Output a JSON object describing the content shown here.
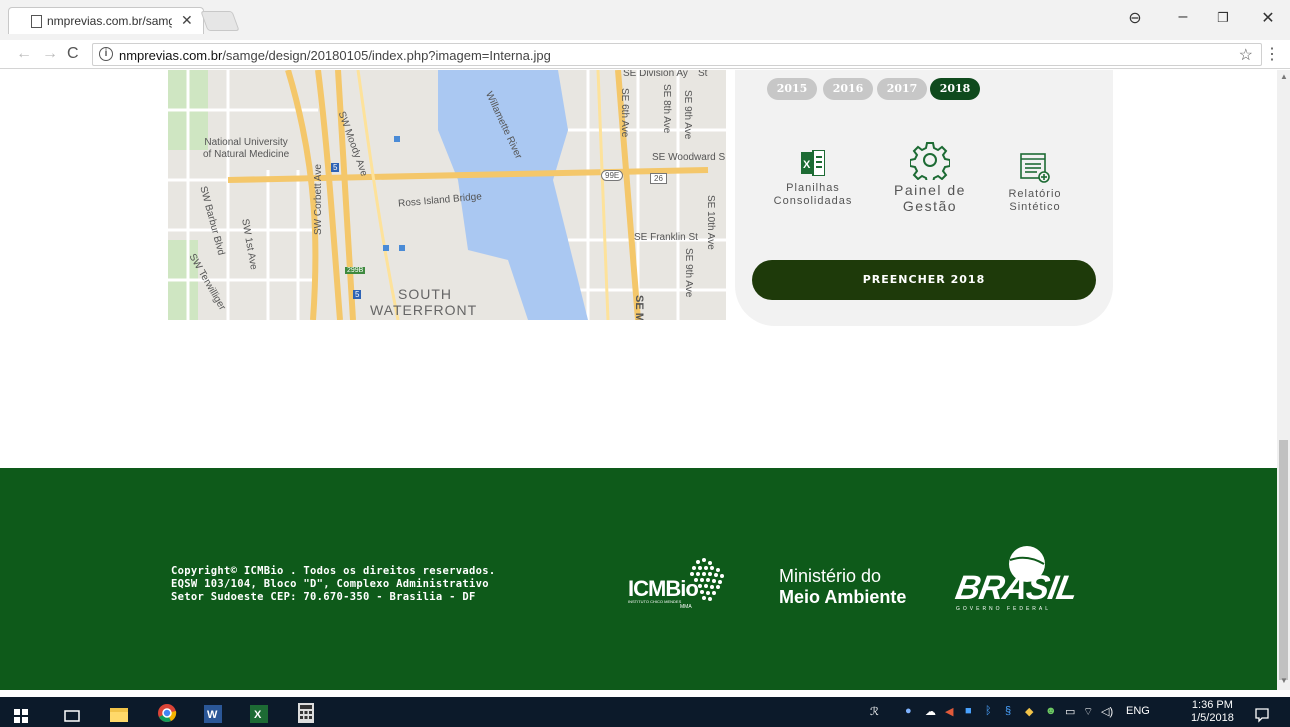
{
  "browser": {
    "tab_title": "nmprevias.com.br/samge",
    "tab_close": "✕",
    "url_host": "nmprevias.com.br",
    "url_path": "/samge/design/20180105/index.php?imagem=Interna.jpg",
    "window_controls": [
      "⊖",
      "–",
      "❐",
      "✕"
    ]
  },
  "map": {
    "labels": {
      "division": "SE Division Ay",
      "st": "St",
      "moody": "SW Moody Ave",
      "willamette": "Willamette River",
      "se6th": "SE 6th Ave",
      "se8th": "SE 8th Ave",
      "se9th_top": "SE 9th Ave",
      "woodward": "SE Woodward S",
      "university": "National University\nof Natural Medicine",
      "ross": "Ross Island Bridge",
      "barbur": "SW Barbur Blvd",
      "sw1st": "SW 1st Ave",
      "corbett": "SW Corbett Ave",
      "franklin": "SE Franklin St",
      "se10th": "SE 10th Ave",
      "se9th_bot": "SE 9th Ave",
      "terwilliger": "SW Terwilliger",
      "south": "SOUTH",
      "waterfront": "WATERFRONT",
      "shield_99e": "99E",
      "shield_26": "26",
      "shield_299b": "299B",
      "shield_5": "5",
      "semi": "SE M"
    }
  },
  "card": {
    "years": [
      "2015",
      "2016",
      "2017",
      "2018"
    ],
    "active_year": "2018",
    "features": {
      "planilhas": "Planilhas\nConsolidadas",
      "painel": "Painel de\nGestão",
      "relatorio": "Relatório\nSintético"
    },
    "cta_label": "PREENCHER 2018"
  },
  "footer": {
    "copyright": "Copyright© ICMBio . Todos os direitos reservados.",
    "address1": "EQSW 103/104, Bloco \"D\", Complexo Administrativo",
    "address2": "Setor Sudoeste CEP: 70.670-350 - Brasilia - DF",
    "icmbio": "ICMBio",
    "icmbio_sub": "INSTITUTO CHICO MENDES",
    "mma": "MMA",
    "ministerio_line1": "Ministério do",
    "ministerio_line2": "Meio Ambiente",
    "brasil": "BRASIL",
    "governo": "GOVERNO FEDERAL"
  },
  "taskbar": {
    "lang": "ENG",
    "time": "1:36 PM",
    "date": "1/5/2018"
  }
}
